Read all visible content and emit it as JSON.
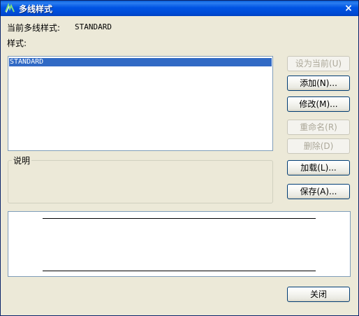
{
  "window": {
    "title": "多线样式",
    "close_glyph": "×"
  },
  "current_style": {
    "label": "当前多线样式:",
    "value": "STANDARD"
  },
  "styles": {
    "label": "样式:",
    "items": [
      {
        "name": "STANDARD",
        "selected": true
      }
    ]
  },
  "description": {
    "label": "说明"
  },
  "buttons": {
    "set_current": {
      "label": "设为当前(U)",
      "enabled": false
    },
    "add": {
      "label": "添加(N)...",
      "enabled": true
    },
    "modify": {
      "label": "修改(M)...",
      "enabled": true
    },
    "rename": {
      "label": "重命名(R)",
      "enabled": false
    },
    "delete": {
      "label": "删除(D)",
      "enabled": false
    },
    "load": {
      "label": "加载(L)...",
      "enabled": true
    },
    "save": {
      "label": "保存(A)...",
      "enabled": true
    },
    "close": {
      "label": "关闭",
      "enabled": true
    }
  },
  "colors": {
    "titlebar": "#0054e3",
    "selection": "#316ac5",
    "dialog_bg": "#ece9d8"
  }
}
